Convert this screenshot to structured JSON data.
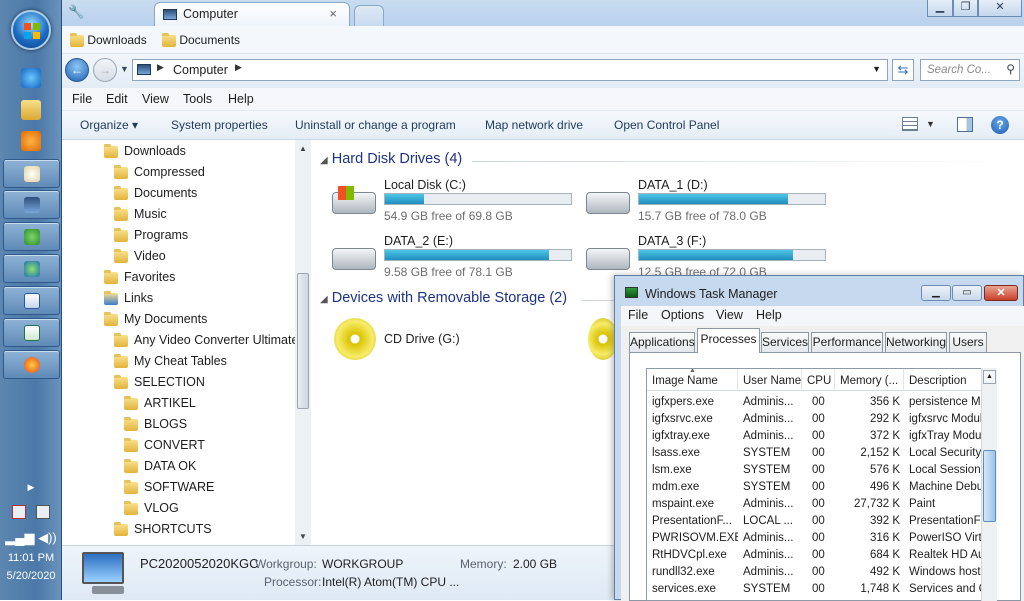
{
  "window": {
    "tab_title": "Computer",
    "close_tab": "×",
    "minimize": "▁",
    "maximize": "❐",
    "close": "✕"
  },
  "favorites": [
    {
      "label": "Downloads"
    },
    {
      "label": "Documents"
    }
  ],
  "address": {
    "path": "Computer",
    "search_placeholder": "Search Co..."
  },
  "menu": [
    "File",
    "Edit",
    "View",
    "Tools",
    "Help"
  ],
  "commands": [
    "Organize ▾",
    "System properties",
    "Uninstall or change a program",
    "Map network drive",
    "Open Control Panel"
  ],
  "tree": [
    "Downloads",
    "Compressed",
    "Documents",
    "Music",
    "Programs",
    "Video",
    "Favorites",
    "Links",
    "My Documents",
    "Any Video Converter Ultimate",
    "My Cheat Tables",
    "SELECTION",
    "ARTIKEL",
    "BLOGS",
    "CONVERT",
    "DATA OK",
    "SOFTWARE",
    "VLOG",
    "SHORTCUTS"
  ],
  "groups": {
    "hdd": "Hard Disk Drives (4)",
    "removable": "Devices with Removable Storage (2)"
  },
  "drives": [
    {
      "name": "Local Disk (C:)",
      "free": "54.9 GB free of 69.8 GB",
      "used_fraction": 0.21
    },
    {
      "name": "DATA_1 (D:)",
      "free": "15.7 GB free of 78.0 GB",
      "used_fraction": 0.8
    },
    {
      "name": "DATA_2 (E:)",
      "free": "9.58 GB free of 78.1 GB",
      "used_fraction": 0.88
    },
    {
      "name": "DATA_3 (F:)",
      "free": "12.5 GB free of 72.0 GB",
      "used_fraction": 0.83
    }
  ],
  "cd_drive": "CD Drive (G:)",
  "details": {
    "pc_name": "PC2020052020KGC",
    "workgroup_label": "Workgroup:",
    "workgroup": "WORKGROUP",
    "memory_label": "Memory:",
    "memory": "2.00 GB",
    "processor_label": "Processor:",
    "processor": "Intel(R) Atom(TM) CPU ..."
  },
  "taskmgr": {
    "title": "Windows Task Manager",
    "menu": [
      "File",
      "Options",
      "View",
      "Help"
    ],
    "tabs": [
      "Applications",
      "Processes",
      "Services",
      "Performance",
      "Networking",
      "Users"
    ],
    "columns": [
      "Image Name",
      "User Name",
      "CPU",
      "Memory (...",
      "Description"
    ],
    "rows": [
      [
        "igfxpers.exe",
        "Adminis...",
        "00",
        "356 K",
        "persistence Mo"
      ],
      [
        "igfxsrvc.exe",
        "Adminis...",
        "00",
        "292 K",
        "igfxsrvc Modul"
      ],
      [
        "igfxtray.exe",
        "Adminis...",
        "00",
        "372 K",
        "igfxTray Modu"
      ],
      [
        "lsass.exe",
        "SYSTEM",
        "00",
        "2,152 K",
        "Local Security"
      ],
      [
        "lsm.exe",
        "SYSTEM",
        "00",
        "576 K",
        "Local Session M"
      ],
      [
        "mdm.exe",
        "SYSTEM",
        "00",
        "496 K",
        "Machine Debu"
      ],
      [
        "mspaint.exe",
        "Adminis...",
        "00",
        "27,732 K",
        "Paint"
      ],
      [
        "PresentationF...",
        "LOCAL ...",
        "00",
        "392 K",
        "PresentationFo"
      ],
      [
        "PWRISOVM.EXE",
        "Adminis...",
        "00",
        "316 K",
        "PowerISO Virt"
      ],
      [
        "RtHDVCpl.exe",
        "Adminis...",
        "00",
        "684 K",
        "Realtek HD Au"
      ],
      [
        "rundll32.exe",
        "Adminis...",
        "00",
        "492 K",
        "Windows host"
      ],
      [
        "services.exe",
        "SYSTEM",
        "00",
        "1,748 K",
        "Services and C"
      ]
    ]
  },
  "clock": {
    "time": "11:01 PM",
    "date": "5/20/2020"
  }
}
